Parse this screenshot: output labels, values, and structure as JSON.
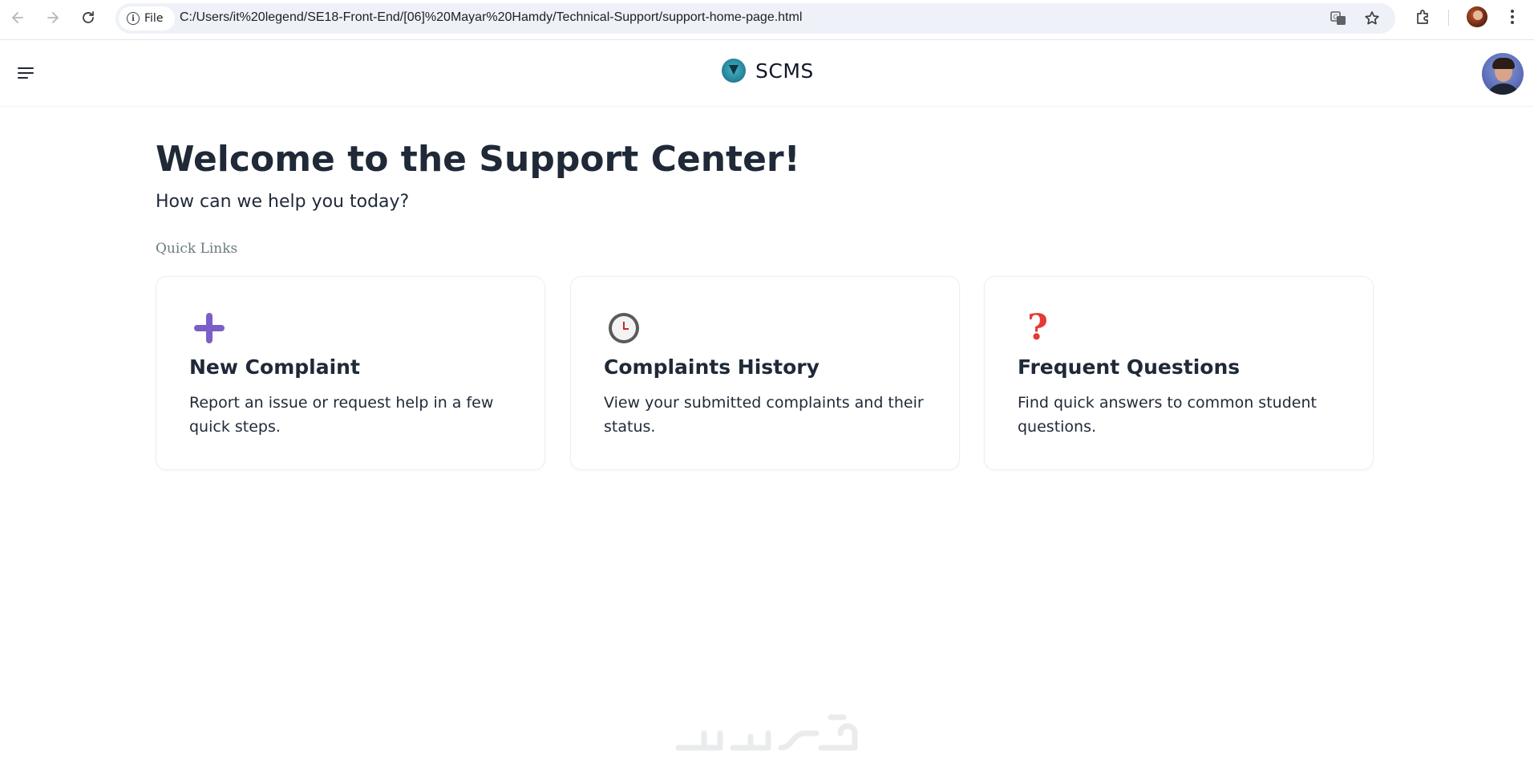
{
  "browser": {
    "site_chip_label": "File",
    "url": "C:/Users/it%20legend/SE18-Front-End/[06]%20Mayar%20Hamdy/Technical-Support/support-home-page.html"
  },
  "header": {
    "brand_name": "SCMS"
  },
  "main": {
    "title": "Welcome to the Support Center!",
    "subtitle": "How can we help you today?",
    "section_label": "Quick Links",
    "cards": [
      {
        "title": "New Complaint",
        "description": "Report an issue or request help in a few quick steps.",
        "icon": "plus-icon"
      },
      {
        "title": "Complaints History",
        "description": "View your submitted complaints and their status.",
        "icon": "clock-icon"
      },
      {
        "title": "Frequent Questions",
        "description": "Find quick answers to common student questions.",
        "icon": "question-icon"
      }
    ]
  },
  "colors": {
    "plus_icon": "#7b5fc8",
    "question_icon": "#e53935",
    "text_primary": "#1f2937",
    "section_label": "#6b7c7f"
  }
}
